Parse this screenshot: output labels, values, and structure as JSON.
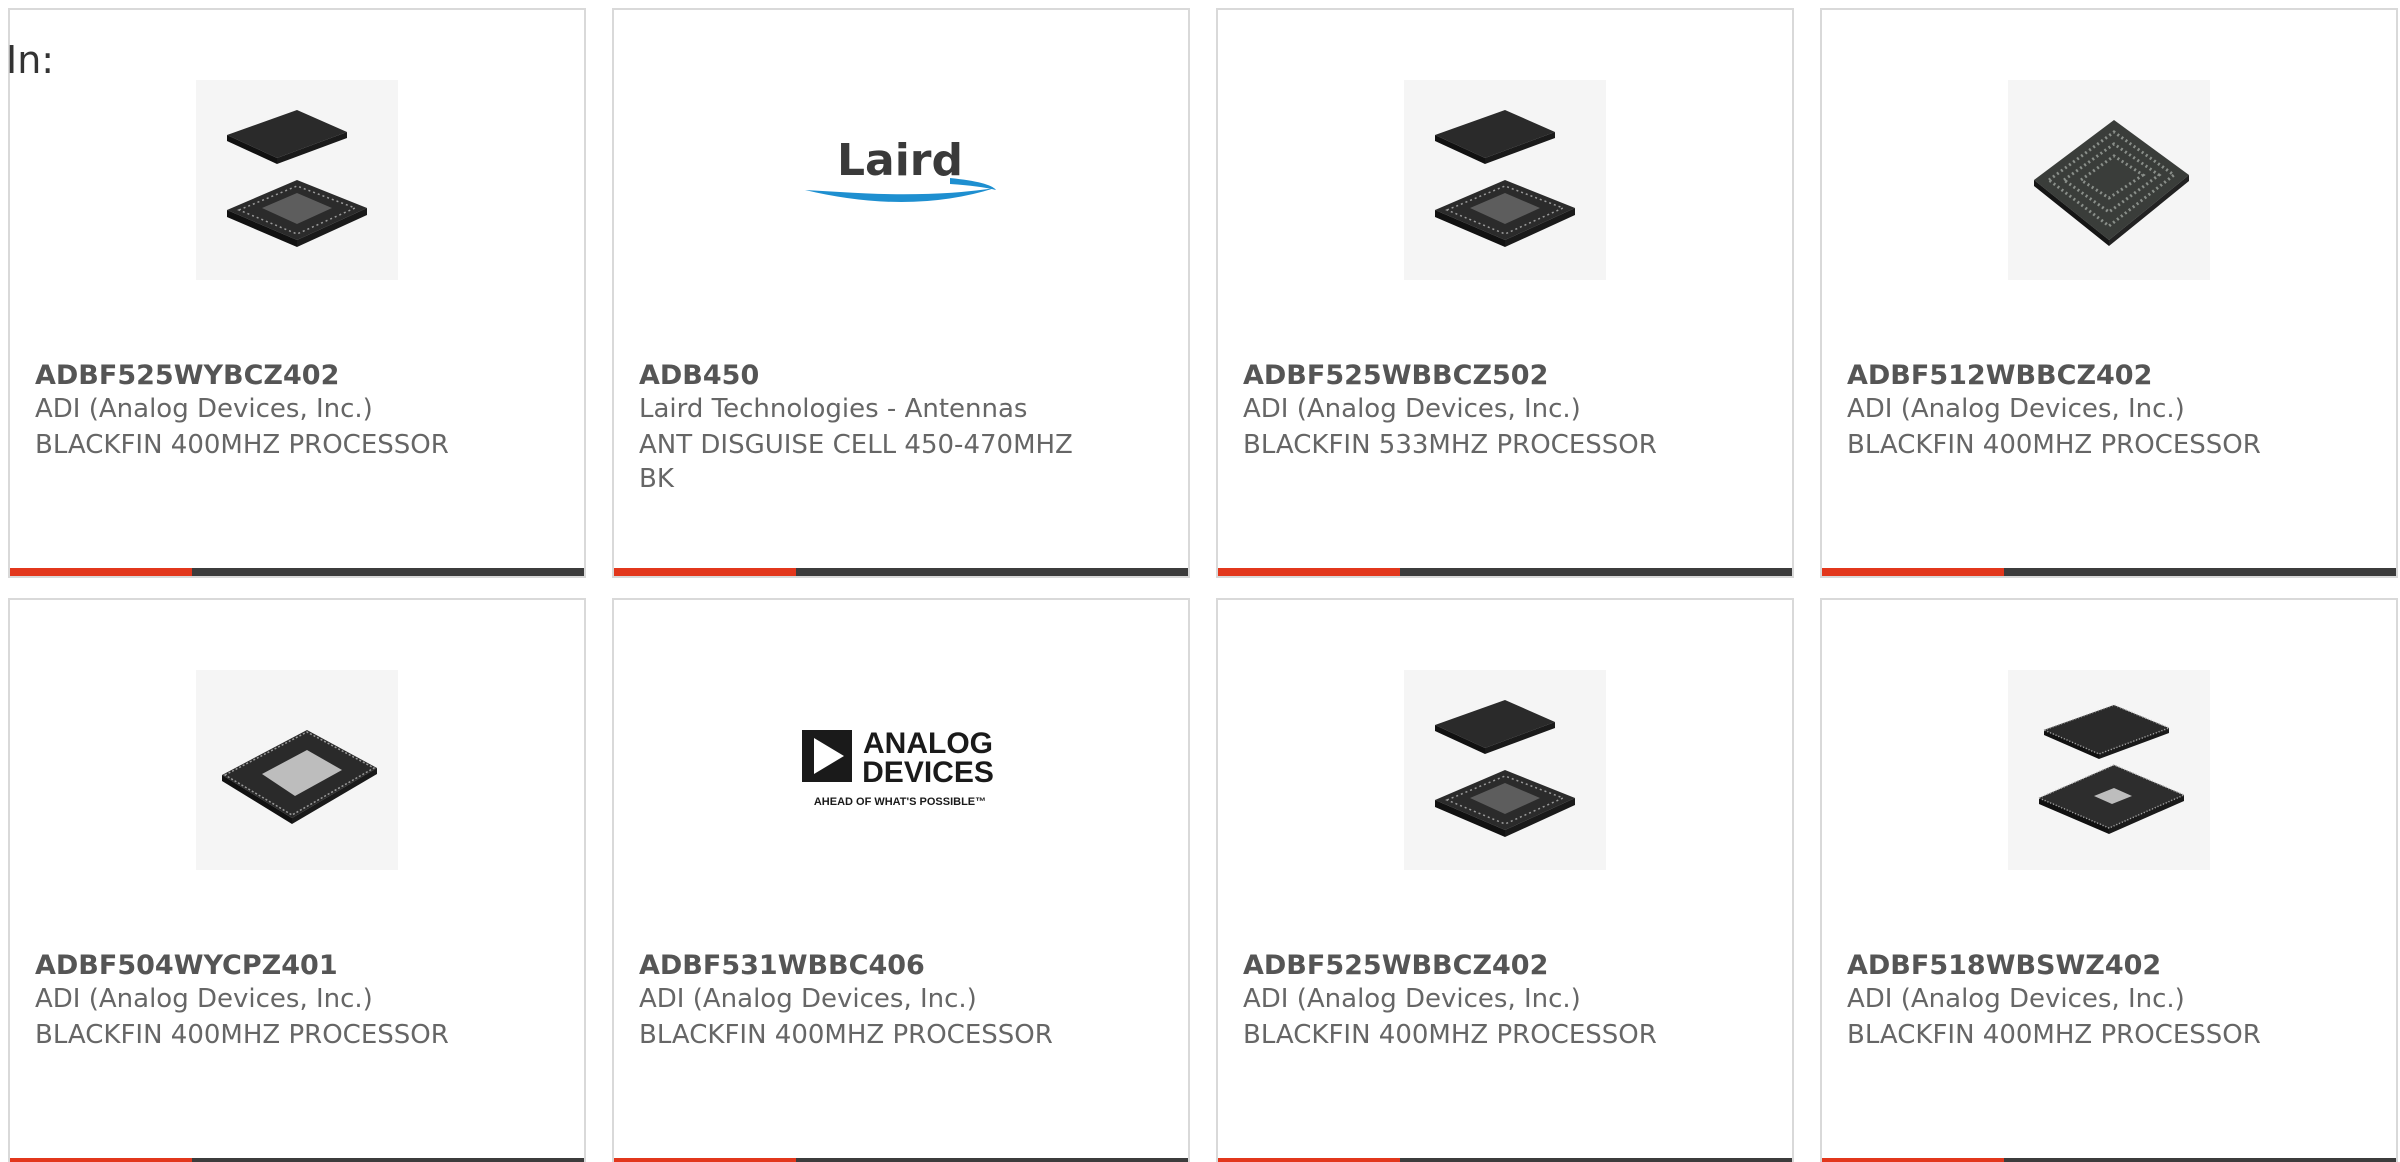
{
  "header": {
    "label": "In:"
  },
  "products": [
    {
      "part": "ADBF525WYBCZ402",
      "manufacturer": "ADI (Analog Devices, Inc.)",
      "description": "BLACKFIN 400MHZ PROCESSOR",
      "image": "bga-chip-pair-icon"
    },
    {
      "part": "ADB450",
      "manufacturer": "Laird Technologies - Antennas",
      "description": "ANT DISGUISE CELL 450-470MHZ BK",
      "image": "laird-logo"
    },
    {
      "part": "ADBF525WBBCZ502",
      "manufacturer": "ADI (Analog Devices, Inc.)",
      "description": "BLACKFIN 533MHZ PROCESSOR",
      "image": "bga-chip-pair-icon"
    },
    {
      "part": "ADBF512WBBCZ402",
      "manufacturer": "ADI (Analog Devices, Inc.)",
      "description": "BLACKFIN 400MHZ PROCESSOR",
      "image": "bga-chip-icon"
    },
    {
      "part": "ADBF504WYCPZ401",
      "manufacturer": "ADI (Analog Devices, Inc.)",
      "description": "BLACKFIN 400MHZ PROCESSOR",
      "image": "lfcsp-chip-icon"
    },
    {
      "part": "ADBF531WBBC406",
      "manufacturer": "ADI (Analog Devices, Inc.)",
      "description": "BLACKFIN 400MHZ PROCESSOR",
      "image": "analog-devices-logo"
    },
    {
      "part": "ADBF525WBBCZ402",
      "manufacturer": "ADI (Analog Devices, Inc.)",
      "description": "BLACKFIN 400MHZ PROCESSOR",
      "image": "bga-chip-pair-icon"
    },
    {
      "part": "ADBF518WBSWZ402",
      "manufacturer": "ADI (Analog Devices, Inc.)",
      "description": "BLACKFIN 400MHZ PROCESSOR",
      "image": "lqfp-chip-pair-icon"
    }
  ],
  "logos": {
    "laird": "Laird",
    "analog_devices_line1": "ANALOG",
    "analog_devices_line2": "DEVICES",
    "analog_devices_tagline": "AHEAD OF WHAT'S POSSIBLE™"
  },
  "colors": {
    "accent": "#e2371c",
    "bar": "#3c3c3c",
    "border": "#d9d9d9",
    "laird_blue": "#1e8fd0"
  }
}
